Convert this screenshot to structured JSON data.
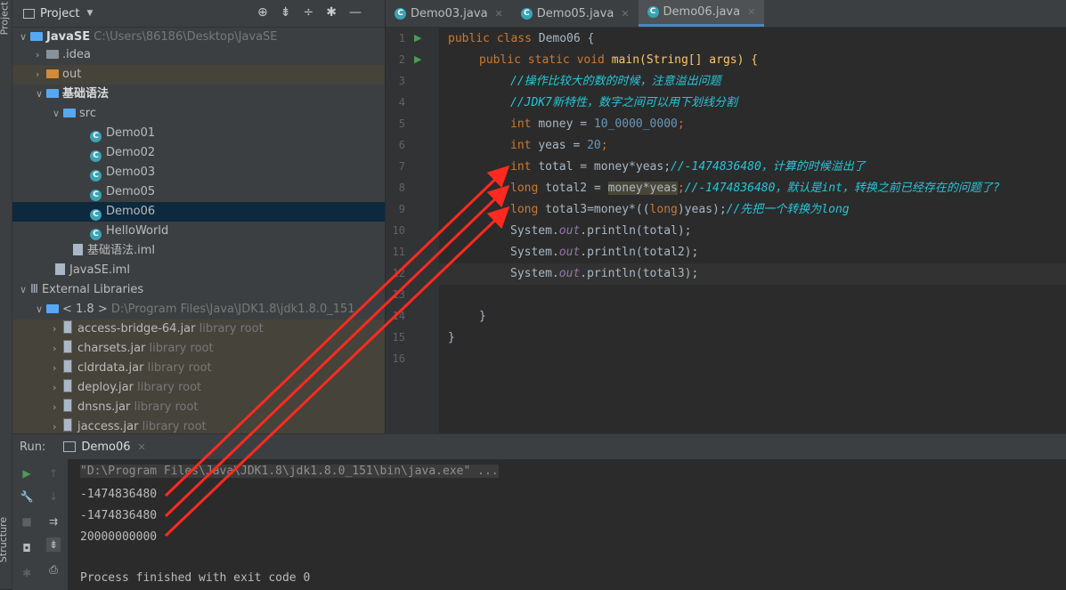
{
  "left_strip": {
    "top_label": "Project",
    "bottom_label": "Structure"
  },
  "project": {
    "header": "Project",
    "items": [
      {
        "name": "JavaSE",
        "path": "C:\\Users\\86186\\Desktop\\JavaSE"
      },
      {
        "name": ".idea"
      },
      {
        "name": "out"
      },
      {
        "name": "基础语法"
      },
      {
        "name": "src"
      },
      {
        "name": "Demo01"
      },
      {
        "name": "Demo02"
      },
      {
        "name": "Demo03"
      },
      {
        "name": "Demo05"
      },
      {
        "name": "Demo06"
      },
      {
        "name": "HelloWorld"
      },
      {
        "name": "基础语法.iml"
      },
      {
        "name": "JavaSE.iml"
      },
      {
        "name": "External Libraries"
      },
      {
        "name": "< 1.8 >",
        "path": "D:\\Program Files\\Java\\JDK1.8\\jdk1.8.0_151"
      },
      {
        "name": "access-bridge-64.jar",
        "suffix": "library root"
      },
      {
        "name": "charsets.jar",
        "suffix": "library root"
      },
      {
        "name": "cldrdata.jar",
        "suffix": "library root"
      },
      {
        "name": "deploy.jar",
        "suffix": "library root"
      },
      {
        "name": "dnsns.jar",
        "suffix": "library root"
      },
      {
        "name": "jaccess.jar",
        "suffix": "library root"
      }
    ]
  },
  "editor": {
    "tabs": [
      {
        "label": "Demo03.java"
      },
      {
        "label": "Demo05.java"
      },
      {
        "label": "Demo06.java"
      }
    ],
    "line_numbers": [
      "1",
      "2",
      "3",
      "4",
      "5",
      "6",
      "7",
      "8",
      "9",
      "10",
      "11",
      "12",
      "13",
      "14",
      "15",
      "16"
    ]
  },
  "code": {
    "l1_kw": "public class ",
    "l1_name": "Demo06 {",
    "l2_kw": "public static void ",
    "l2_rest": "main(String[] args) {",
    "l3": "//操作比较大的数的时候，注意溢出问题",
    "l4": "//JDK7新特性，数字之间可以用下划线分割",
    "l5_kw": "int ",
    "l5_a": "money = ",
    "l5_num": "10_0000_0000",
    "l5_b": ";",
    "l6_kw": "int ",
    "l6_a": "yeas = ",
    "l6_num": "20",
    "l6_b": ";",
    "l7_kw": "int ",
    "l7_a": "total = money*yeas;",
    "l7_c": "//-1474836480，计算的时候溢出了",
    "l8_kw": "long ",
    "l8_a": "total2 = ",
    "l8_sel": "money*yeas",
    "l8_b": ";",
    "l8_c": "//-1474836480，默认是int，转换之前已经存在的问题了?",
    "l9_kw": "long ",
    "l9_a": "total3=money*((",
    "l9_kw2": "long",
    "l9_b": ")yeas);",
    "l9_c": "//先把一个转换为long",
    "l10_a": "System.",
    "l10_f": "out",
    "l10_b": ".println(total);",
    "l11_a": "System.",
    "l11_f": "out",
    "l11_b": ".println(total2);",
    "l12_a": "System.",
    "l12_f": "out",
    "l12_b": ".println(total3);",
    "l14": "}",
    "l15": "}"
  },
  "run": {
    "label": "Run:",
    "tab": "Demo06",
    "output": [
      "\"D:\\Program Files\\Java\\JDK1.8\\jdk1.8.0_151\\bin\\java.exe\" ...",
      "-1474836480",
      "-1474836480",
      "20000000000",
      "",
      "Process finished with exit code 0"
    ]
  },
  "colors": {
    "arrow": "#ff2a1f",
    "accent": "#4a88c7",
    "background": "#2b2b2b"
  }
}
